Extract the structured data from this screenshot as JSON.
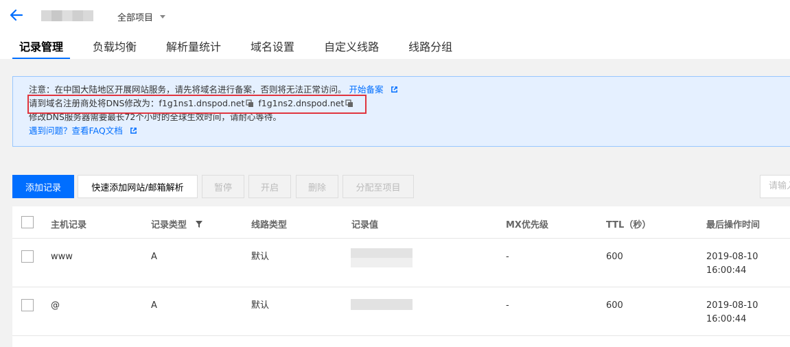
{
  "header": {
    "project_selector": "全部项目"
  },
  "tabs": [
    {
      "label": "记录管理",
      "active": true
    },
    {
      "label": "负载均衡"
    },
    {
      "label": "解析量统计"
    },
    {
      "label": "域名设置"
    },
    {
      "label": "自定义线路"
    },
    {
      "label": "线路分组"
    }
  ],
  "notice": {
    "line1_text": "注意：在中国大陆地区开展网站服务，请先将域名进行备案，否则将无法正常访问。",
    "line1_link": "开始备案",
    "line2_prefix": "请到域名注册商处将DNS修改为：",
    "ns1": "f1g1ns1.dnspod.net",
    "ns2": "f1g1ns2.dnspod.net",
    "line3_text": "修改DNS服务器需要最长72个小时的全球生效时间，请耐心等待。",
    "line4_link": "遇到问题？查看FAQ文档"
  },
  "toolbar": {
    "add_record": "添加记录",
    "quick_add": "快速添加网站/邮箱解析",
    "pause": "暂停",
    "enable": "开启",
    "delete": "删除",
    "assign_project": "分配至项目",
    "search_placeholder": "请输入"
  },
  "table": {
    "columns": [
      "主机记录",
      "记录类型",
      "线路类型",
      "记录值",
      "MX优先级",
      "TTL（秒）",
      "最后操作时间"
    ],
    "rows": [
      {
        "host": "www",
        "type": "A",
        "line": "默认",
        "mx": "-",
        "ttl": "600",
        "time_date": "2019-08-10",
        "time_clock": "16:00:44"
      },
      {
        "host": "@",
        "type": "A",
        "line": "默认",
        "mx": "-",
        "ttl": "600",
        "time_date": "2019-08-10",
        "time_clock": "16:00:44"
      }
    ]
  },
  "colors": {
    "accent": "#006eff",
    "notice_bg": "#e5f0ff",
    "highlight_border": "#e0343e"
  }
}
